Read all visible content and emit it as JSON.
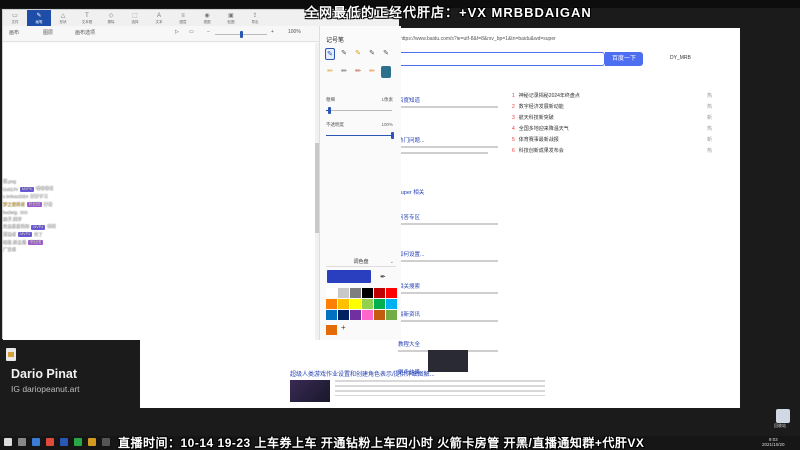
{
  "overlay": {
    "top_banner": "全网最低的正经代肝店：+VX MRBBDAIGAN",
    "bottom_banner": "直播时间：10-14 19-23 上车券上车 开通钻粉上车四小时 火箭卡房管 开黑/直播通知群+代肝VX"
  },
  "streamer": {
    "name": "Dario Pinat",
    "ig": "IG dariopeanut.art"
  },
  "app": {
    "ribbon": [
      {
        "label": "文件",
        "icon": "file-icon",
        "glyph": "▭"
      },
      {
        "label": "画笔",
        "icon": "brush-icon",
        "glyph": "✎",
        "active": true
      },
      {
        "label": "形状",
        "icon": "shapes-icon",
        "glyph": "△"
      },
      {
        "label": "文本框",
        "icon": "textbox-icon",
        "glyph": "T"
      },
      {
        "label": "擦除",
        "icon": "eraser-icon",
        "glyph": "◇"
      },
      {
        "label": "选择",
        "icon": "select-icon",
        "glyph": "⬚"
      },
      {
        "label": "文本",
        "icon": "text-icon",
        "glyph": "A"
      },
      {
        "label": "图层",
        "icon": "layers-icon",
        "glyph": "≡"
      },
      {
        "label": "视图",
        "icon": "view-icon",
        "glyph": "◉"
      },
      {
        "label": "贴图",
        "icon": "sticker-icon",
        "glyph": "▣"
      },
      {
        "label": "导出",
        "icon": "export-icon",
        "glyph": "⇪"
      }
    ],
    "toolbar": {
      "item1": "画布",
      "item2": "图层",
      "item3": "画布选项",
      "zoom": "100%"
    },
    "zoom_level": 0.5
  },
  "pen_panel": {
    "title": "记号笔",
    "size_label": "粗细",
    "size_value": "1像素",
    "size_level": 0.05,
    "opacity_label": "不透明度",
    "opacity_value": "100%",
    "opacity_level": 1.0,
    "style_label": "调色盘",
    "colors": [
      "#ffffff",
      "#c8c8c8",
      "#7f7f7f",
      "#000000",
      "#c00000",
      "#ff0000",
      "#ff8000",
      "#ffc000",
      "#ffff00",
      "#92d050",
      "#00b050",
      "#00b0f0",
      "#0070c0",
      "#002060",
      "#7030a0",
      "#ff66cc",
      "#c55a11",
      "#70ad47"
    ],
    "selected_color": "#2a3fc0",
    "custom_color": "#e36c09"
  },
  "chat": [
    {
      "user": "雨.png",
      "badge": "",
      "badge_color": "#777",
      "text": "",
      "color": "#f0f0f0"
    },
    {
      "user": "Gold.Pr",
      "badge": "MVP6",
      "badge_color": "#6b5bd6",
      "text": "嘿嘿嘿嘿",
      "color": "#f0f0f0"
    },
    {
      "user": "c.imhoe2024",
      "badge": "",
      "badge_color": "#777",
      "text": "好好学习",
      "color": "#f0f0f0"
    },
    {
      "user": "梦之使用者",
      "badge": "粉丝团",
      "badge_color": "#a35ad6",
      "text": "好看",
      "color": "#f7d36b"
    },
    {
      "user": "hedwig.",
      "badge": "",
      "badge_color": "#777",
      "text": "666",
      "color": "#f0f0f0"
    },
    {
      "user": "鸽子.同学",
      "badge": "",
      "badge_color": "#3a8a3a",
      "text": "",
      "color": "#f0f0f0"
    },
    {
      "user": "来自星星的你",
      "badge": "MVP4",
      "badge_color": "#6b5bd6",
      "text": "啊啊",
      "color": "#f0f0f0"
    },
    {
      "user": "漂泊者",
      "badge": "MVP3",
      "badge_color": "#6b5bd6",
      "text": "来了",
      "color": "#f0f0f0"
    },
    {
      "user": "帕鲁.新主播",
      "badge": "粉丝团",
      "badge_color": "#a35ad6",
      "text": "",
      "color": "#f0f0f0"
    },
    {
      "user": "广告者",
      "badge": "",
      "badge_color": "#3a8a3a",
      "text": "",
      "color": "#f0f0f0"
    }
  ],
  "browser": {
    "search_button": "百度一下",
    "user": "DY_MRB",
    "hot_items": [
      {
        "n": "1",
        "text": "神秘记录揭秘2024年终盘点",
        "v": "热"
      },
      {
        "n": "2",
        "text": "数字经济发展新动能",
        "v": "热"
      },
      {
        "n": "3",
        "text": "航天科技新突破",
        "v": "新"
      },
      {
        "n": "4",
        "text": "全国多地迎来降温天气",
        "v": "热"
      },
      {
        "n": "5",
        "text": "体育赛事最新战报",
        "v": "新"
      },
      {
        "n": "6",
        "text": "科技创新成果发布会",
        "v": "热"
      }
    ],
    "results": [
      "百度知道",
      "热门问题...",
      "super 相关",
      "问答专区",
      "如何设置...",
      "相关搜索",
      "最新资讯",
      "教程大全",
      "更多结果"
    ],
    "bottom_title": "超级人类游戏作业设置和创建角色表示/提供详细图解..."
  },
  "desktop": {
    "recycle_label": "回收站",
    "clock_time": "9:03",
    "clock_date": "2021/10/20"
  }
}
